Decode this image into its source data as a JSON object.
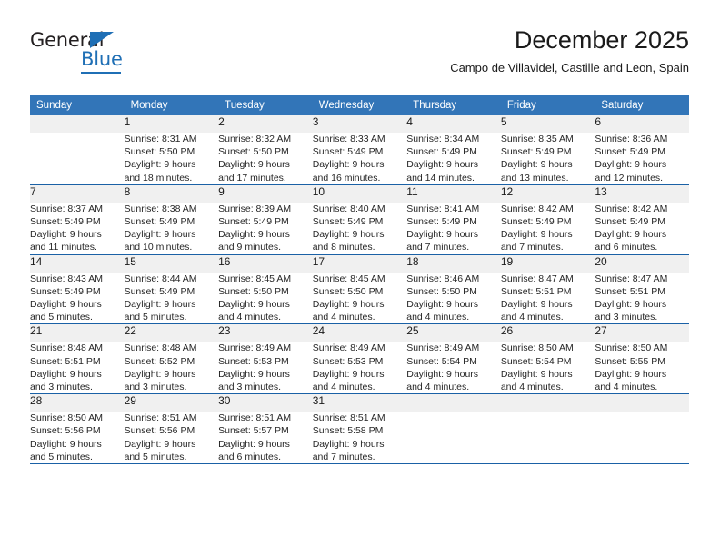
{
  "brand": {
    "name_part1": "General",
    "name_part2": "Blue",
    "triangle_color": "#1f6fb5"
  },
  "header": {
    "title": "December 2025",
    "location": "Campo de Villavidel, Castille and Leon, Spain"
  },
  "theme": {
    "header_row_bg": "#3275b8",
    "week_divider": "#1a61a6",
    "daynum_bg": "#f0f0f0",
    "text": "#262626"
  },
  "calendar": {
    "weekday_headers": [
      "Sunday",
      "Monday",
      "Tuesday",
      "Wednesday",
      "Thursday",
      "Friday",
      "Saturday"
    ],
    "weeks": [
      [
        {
          "day": "",
          "sunrise": "",
          "sunset": "",
          "daylight_line1": "",
          "daylight_line2": "",
          "blank": true
        },
        {
          "day": "1",
          "sunrise": "Sunrise: 8:31 AM",
          "sunset": "Sunset: 5:50 PM",
          "daylight_line1": "Daylight: 9 hours",
          "daylight_line2": "and 18 minutes."
        },
        {
          "day": "2",
          "sunrise": "Sunrise: 8:32 AM",
          "sunset": "Sunset: 5:50 PM",
          "daylight_line1": "Daylight: 9 hours",
          "daylight_line2": "and 17 minutes."
        },
        {
          "day": "3",
          "sunrise": "Sunrise: 8:33 AM",
          "sunset": "Sunset: 5:49 PM",
          "daylight_line1": "Daylight: 9 hours",
          "daylight_line2": "and 16 minutes."
        },
        {
          "day": "4",
          "sunrise": "Sunrise: 8:34 AM",
          "sunset": "Sunset: 5:49 PM",
          "daylight_line1": "Daylight: 9 hours",
          "daylight_line2": "and 14 minutes."
        },
        {
          "day": "5",
          "sunrise": "Sunrise: 8:35 AM",
          "sunset": "Sunset: 5:49 PM",
          "daylight_line1": "Daylight: 9 hours",
          "daylight_line2": "and 13 minutes."
        },
        {
          "day": "6",
          "sunrise": "Sunrise: 8:36 AM",
          "sunset": "Sunset: 5:49 PM",
          "daylight_line1": "Daylight: 9 hours",
          "daylight_line2": "and 12 minutes."
        }
      ],
      [
        {
          "day": "7",
          "sunrise": "Sunrise: 8:37 AM",
          "sunset": "Sunset: 5:49 PM",
          "daylight_line1": "Daylight: 9 hours",
          "daylight_line2": "and 11 minutes."
        },
        {
          "day": "8",
          "sunrise": "Sunrise: 8:38 AM",
          "sunset": "Sunset: 5:49 PM",
          "daylight_line1": "Daylight: 9 hours",
          "daylight_line2": "and 10 minutes."
        },
        {
          "day": "9",
          "sunrise": "Sunrise: 8:39 AM",
          "sunset": "Sunset: 5:49 PM",
          "daylight_line1": "Daylight: 9 hours",
          "daylight_line2": "and 9 minutes."
        },
        {
          "day": "10",
          "sunrise": "Sunrise: 8:40 AM",
          "sunset": "Sunset: 5:49 PM",
          "daylight_line1": "Daylight: 9 hours",
          "daylight_line2": "and 8 minutes."
        },
        {
          "day": "11",
          "sunrise": "Sunrise: 8:41 AM",
          "sunset": "Sunset: 5:49 PM",
          "daylight_line1": "Daylight: 9 hours",
          "daylight_line2": "and 7 minutes."
        },
        {
          "day": "12",
          "sunrise": "Sunrise: 8:42 AM",
          "sunset": "Sunset: 5:49 PM",
          "daylight_line1": "Daylight: 9 hours",
          "daylight_line2": "and 7 minutes."
        },
        {
          "day": "13",
          "sunrise": "Sunrise: 8:42 AM",
          "sunset": "Sunset: 5:49 PM",
          "daylight_line1": "Daylight: 9 hours",
          "daylight_line2": "and 6 minutes."
        }
      ],
      [
        {
          "day": "14",
          "sunrise": "Sunrise: 8:43 AM",
          "sunset": "Sunset: 5:49 PM",
          "daylight_line1": "Daylight: 9 hours",
          "daylight_line2": "and 5 minutes."
        },
        {
          "day": "15",
          "sunrise": "Sunrise: 8:44 AM",
          "sunset": "Sunset: 5:49 PM",
          "daylight_line1": "Daylight: 9 hours",
          "daylight_line2": "and 5 minutes."
        },
        {
          "day": "16",
          "sunrise": "Sunrise: 8:45 AM",
          "sunset": "Sunset: 5:50 PM",
          "daylight_line1": "Daylight: 9 hours",
          "daylight_line2": "and 4 minutes."
        },
        {
          "day": "17",
          "sunrise": "Sunrise: 8:45 AM",
          "sunset": "Sunset: 5:50 PM",
          "daylight_line1": "Daylight: 9 hours",
          "daylight_line2": "and 4 minutes."
        },
        {
          "day": "18",
          "sunrise": "Sunrise: 8:46 AM",
          "sunset": "Sunset: 5:50 PM",
          "daylight_line1": "Daylight: 9 hours",
          "daylight_line2": "and 4 minutes."
        },
        {
          "day": "19",
          "sunrise": "Sunrise: 8:47 AM",
          "sunset": "Sunset: 5:51 PM",
          "daylight_line1": "Daylight: 9 hours",
          "daylight_line2": "and 4 minutes."
        },
        {
          "day": "20",
          "sunrise": "Sunrise: 8:47 AM",
          "sunset": "Sunset: 5:51 PM",
          "daylight_line1": "Daylight: 9 hours",
          "daylight_line2": "and 3 minutes."
        }
      ],
      [
        {
          "day": "21",
          "sunrise": "Sunrise: 8:48 AM",
          "sunset": "Sunset: 5:51 PM",
          "daylight_line1": "Daylight: 9 hours",
          "daylight_line2": "and 3 minutes."
        },
        {
          "day": "22",
          "sunrise": "Sunrise: 8:48 AM",
          "sunset": "Sunset: 5:52 PM",
          "daylight_line1": "Daylight: 9 hours",
          "daylight_line2": "and 3 minutes."
        },
        {
          "day": "23",
          "sunrise": "Sunrise: 8:49 AM",
          "sunset": "Sunset: 5:53 PM",
          "daylight_line1": "Daylight: 9 hours",
          "daylight_line2": "and 3 minutes."
        },
        {
          "day": "24",
          "sunrise": "Sunrise: 8:49 AM",
          "sunset": "Sunset: 5:53 PM",
          "daylight_line1": "Daylight: 9 hours",
          "daylight_line2": "and 4 minutes."
        },
        {
          "day": "25",
          "sunrise": "Sunrise: 8:49 AM",
          "sunset": "Sunset: 5:54 PM",
          "daylight_line1": "Daylight: 9 hours",
          "daylight_line2": "and 4 minutes."
        },
        {
          "day": "26",
          "sunrise": "Sunrise: 8:50 AM",
          "sunset": "Sunset: 5:54 PM",
          "daylight_line1": "Daylight: 9 hours",
          "daylight_line2": "and 4 minutes."
        },
        {
          "day": "27",
          "sunrise": "Sunrise: 8:50 AM",
          "sunset": "Sunset: 5:55 PM",
          "daylight_line1": "Daylight: 9 hours",
          "daylight_line2": "and 4 minutes."
        }
      ],
      [
        {
          "day": "28",
          "sunrise": "Sunrise: 8:50 AM",
          "sunset": "Sunset: 5:56 PM",
          "daylight_line1": "Daylight: 9 hours",
          "daylight_line2": "and 5 minutes."
        },
        {
          "day": "29",
          "sunrise": "Sunrise: 8:51 AM",
          "sunset": "Sunset: 5:56 PM",
          "daylight_line1": "Daylight: 9 hours",
          "daylight_line2": "and 5 minutes."
        },
        {
          "day": "30",
          "sunrise": "Sunrise: 8:51 AM",
          "sunset": "Sunset: 5:57 PM",
          "daylight_line1": "Daylight: 9 hours",
          "daylight_line2": "and 6 minutes."
        },
        {
          "day": "31",
          "sunrise": "Sunrise: 8:51 AM",
          "sunset": "Sunset: 5:58 PM",
          "daylight_line1": "Daylight: 9 hours",
          "daylight_line2": "and 7 minutes."
        },
        {
          "day": "",
          "sunrise": "",
          "sunset": "",
          "daylight_line1": "",
          "daylight_line2": "",
          "blank": true
        },
        {
          "day": "",
          "sunrise": "",
          "sunset": "",
          "daylight_line1": "",
          "daylight_line2": "",
          "blank": true
        },
        {
          "day": "",
          "sunrise": "",
          "sunset": "",
          "daylight_line1": "",
          "daylight_line2": "",
          "blank": true
        }
      ]
    ]
  }
}
